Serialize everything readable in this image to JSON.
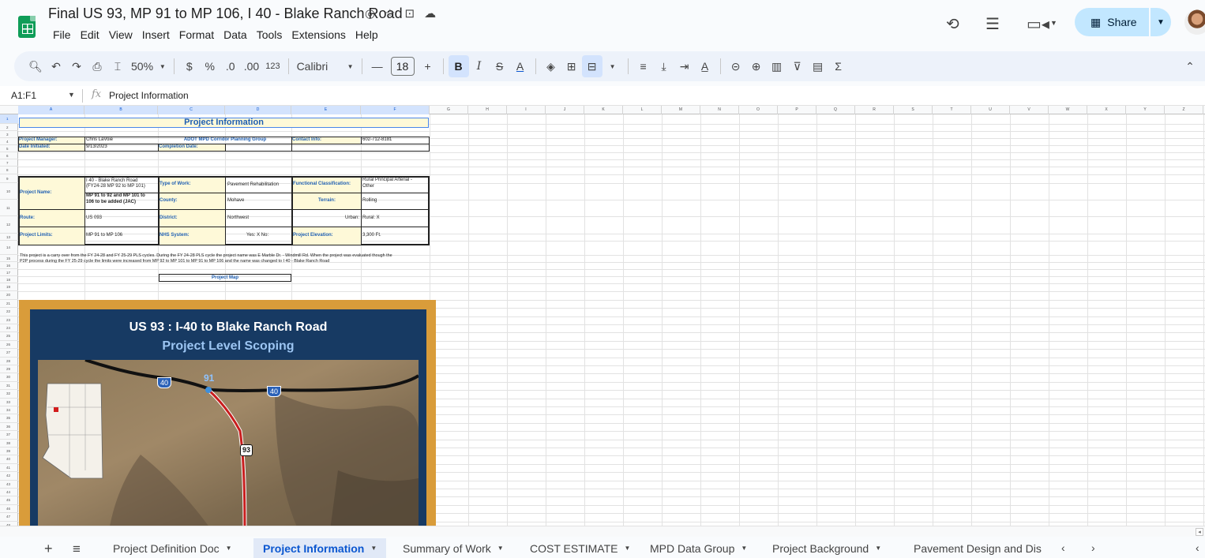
{
  "doc": {
    "title": "Final US 93, MP 91 to MP 106, I 40 - Blake Ranch Road",
    "menu": [
      "File",
      "Edit",
      "View",
      "Insert",
      "Format",
      "Data",
      "Tools",
      "Extensions",
      "Help"
    ],
    "share_label": "Share"
  },
  "toolbar": {
    "zoom": "50%",
    "currency": "$",
    "percent": "%",
    "dec_decrease": ".0",
    "dec_increase": ".00",
    "number_format": "123",
    "font": "Calibri",
    "font_size": "18",
    "bold": "B",
    "italic": "I",
    "text_color": "A",
    "sum": "Σ"
  },
  "formula": {
    "cell_ref": "A1:F1",
    "fx": "fx",
    "value": "Project Information"
  },
  "columns": [
    "A",
    "B",
    "C",
    "D",
    "E",
    "F",
    "G",
    "H",
    "I",
    "J",
    "K",
    "L",
    "M",
    "N",
    "O",
    "P",
    "Q",
    "R",
    "S",
    "T",
    "U",
    "V",
    "W",
    "X",
    "Y",
    "Z"
  ],
  "rows": [
    "1",
    "2",
    "3",
    "4",
    "5",
    "6",
    "7",
    "8",
    "9",
    "10",
    "11",
    "12",
    "13",
    "14",
    "15",
    "16",
    "17",
    "18",
    "19",
    "20",
    "21",
    "22",
    "23",
    "24",
    "25",
    "26",
    "27",
    "28",
    "29",
    "30",
    "31",
    "32",
    "33",
    "34",
    "35",
    "36",
    "37",
    "38",
    "39",
    "40",
    "41",
    "42",
    "43",
    "44",
    "45",
    "46",
    "47",
    "48"
  ],
  "sheet": {
    "header": "Project Information",
    "project_manager_label": "Project Manager:",
    "project_manager": "Chris LaVoie",
    "group": "ADOT MPD Corridor Planning Group",
    "contact_label": "Contact Info:",
    "contact": "602-712-8181",
    "date_initiated_label": "Date Initiated:",
    "date_initiated": "9/13/2023",
    "completion_label": "Completion Date:",
    "project_name_label": "Project Name:",
    "project_name_1": "I 40 - Blake Ranch Road",
    "project_name_2": "(FY24-28 MP 92 to MP 101)",
    "project_name_3": "MP 91 to 92 and MP 101 to",
    "project_name_4": "106 to be added (JAC)",
    "type_of_work_label": "Type of Work:",
    "type_of_work": "Pavement Rehabilitation",
    "functional_class_label": "Functional Classification:",
    "functional_class_1": "Rural Principal Arterial -",
    "functional_class_2": "Other",
    "county_label": "County:",
    "county": "Mohave",
    "terrain_label": "Terrain:",
    "terrain": "Rolling",
    "route_label": "Route:",
    "route": "US 093",
    "district_label": "District:",
    "district": "Northwest",
    "urban_label": "Urban:",
    "rural": "Rural: X",
    "limits_label": "Project Limits:",
    "limits": "MP 91 to MP 106",
    "nhs_label": "NHS System:",
    "nhs": "Yes:  X   No:",
    "elevation_label": "Project Elevation:",
    "elevation": "3,300 Ft.",
    "note_1": "This project is a carry over from the FY 24-28 and FY 25-29 PLS cycles. During the FY 24-28 PLS cycle the project name was E Marble Dr. - Windmill Rd. When the project was evaluated though the",
    "note_2": "P2P process during the FY 25-29 cycle the limits were increased from MP 92 to MP 101 to MP 91 to MP 106 and the name was changed to I 40 - Blake Ranch Road",
    "project_map_label": "Project Map"
  },
  "map": {
    "title": "US 93 : I-40 to Blake Ranch Road",
    "subtitle": "Project Level Scoping",
    "shield_1": "40",
    "shield_2": "40",
    "mile_marker": "91",
    "route_shield": "93"
  },
  "tabs": [
    {
      "label": "Project Definition Doc",
      "active": false
    },
    {
      "label": "Project Information",
      "active": true
    },
    {
      "label": "Summary of Work",
      "active": false
    },
    {
      "label": "COST ESTIMATE",
      "active": false
    },
    {
      "label": "MPD Data Group",
      "active": false
    },
    {
      "label": "Project Background",
      "active": false
    },
    {
      "label": "Pavement Design and Dis",
      "active": false
    }
  ],
  "colors": {
    "accent": "#0b57d0",
    "share_bg": "#c2e7ff",
    "label_blue": "#1f5fb2",
    "cell_yellow": "#fef9d8",
    "map_frame": "#d99c3a",
    "map_bg": "#173a63"
  }
}
